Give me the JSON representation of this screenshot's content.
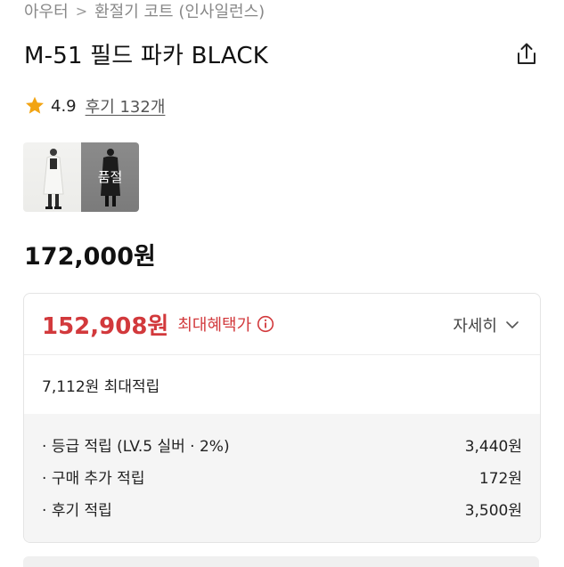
{
  "breadcrumb": {
    "items": [
      "아우터",
      "환절기 코트 (인사일런스)"
    ],
    "separator": ">"
  },
  "product": {
    "title": "M-51 필드 파카 BLACK",
    "rating": "4.9",
    "reviews_link": "후기 132개",
    "thumbnails": [
      {
        "alt": "thumbnail-1",
        "sold_out": false
      },
      {
        "alt": "thumbnail-2",
        "sold_out": true,
        "sold_out_label": "품절"
      }
    ],
    "list_price": "172,000원"
  },
  "pricing": {
    "sale_price": "152,908원",
    "benefit_label": "최대혜택가",
    "detail_label": "자세히",
    "points_summary": "7,112원 최대적립",
    "points_breakdown": [
      {
        "label": "등급 적립 (LV.5 실버 · 2%)",
        "value": "3,440원"
      },
      {
        "label": "구매 추가 적립",
        "value": "172원"
      },
      {
        "label": "후기 적립",
        "value": "3,500원"
      }
    ]
  },
  "colors": {
    "accent_red": "#d2393c",
    "star": "#f2a413",
    "text_primary": "#111111",
    "text_muted": "#888888"
  },
  "icons": {
    "share": "share-icon",
    "star": "star-icon",
    "info": "info-icon",
    "chevron": "chevron-down-icon"
  }
}
